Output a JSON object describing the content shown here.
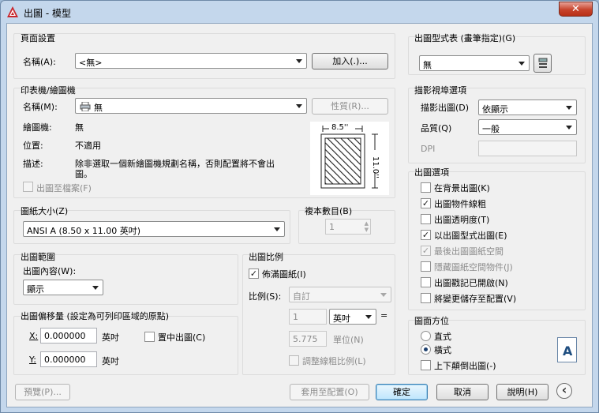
{
  "window": {
    "title": "出圖 - 模型",
    "close": "✕"
  },
  "page_setup": {
    "group": "頁面設置",
    "name_label": "名稱(A):",
    "name_value": "<無>",
    "add_button": "加入(.)..."
  },
  "printer": {
    "group": "印表機/繪圖機",
    "name_label": "名稱(M):",
    "name_value": "無",
    "properties_button": "性質(R)...",
    "plotter_label": "繪圖機:",
    "plotter_value": "無",
    "location_label": "位置:",
    "location_value": "不適用",
    "desc_label": "描述:",
    "desc_line1": "除非選取一個新繪圖機規劃名稱，否則配置將不會出",
    "desc_line2": "圖。",
    "plot_to_file": "出圖至檔案(F)",
    "paper_width": "8.5''",
    "paper_height": "11.0''"
  },
  "paper_size": {
    "group": "圖紙大小(Z)",
    "value": "ANSI A (8.50 x 11.00 英吋)"
  },
  "copies": {
    "group": "複本數目(B)",
    "value": "1"
  },
  "plot_area": {
    "group": "出圖範圍",
    "label": "出圖內容(W):",
    "value": "顯示"
  },
  "plot_offset": {
    "group": "出圖偏移量 (設定為可列印區域的原點)",
    "x_label": "X:",
    "x_value": "0.000000",
    "x_unit": "英吋",
    "y_label": "Y:",
    "y_value": "0.000000",
    "y_unit": "英吋",
    "center": "置中出圖(C)"
  },
  "plot_scale": {
    "group": "出圖比例",
    "fit": "佈滿圖紙(I)",
    "scale_label": "比例(S):",
    "scale_value": "自訂",
    "num_value": "1",
    "unit_value": "英吋",
    "equals": "=",
    "units_value": "5.775",
    "units_label": "單位(N)",
    "scale_lineweights": "調整線粗比例(L)"
  },
  "plot_style_table": {
    "group": "出圖型式表 (畫筆指定)(G)",
    "value": "無"
  },
  "shaded_viewport": {
    "group": "描影視埠選項",
    "shade_label": "描影出圖(D)",
    "shade_value": "依顯示",
    "quality_label": "品質(Q)",
    "quality_value": "一般",
    "dpi_label": "DPI"
  },
  "plot_options": {
    "group": "出圖選項",
    "items": [
      {
        "label": "在背景出圖(K)",
        "mark": ""
      },
      {
        "label": "出圖物件線粗",
        "mark": "✓"
      },
      {
        "label": "出圖透明度(T)",
        "mark": ""
      },
      {
        "label": "以出圖型式出圖(E)",
        "mark": "✓"
      },
      {
        "label": "最後出圖圖紙空間",
        "mark": "✓"
      },
      {
        "label": "隱藏圖紙空間物件(J)",
        "mark": ""
      },
      {
        "label": "出圖戳記已開啟(N)",
        "mark": ""
      },
      {
        "label": "將變更儲存至配置(V)",
        "mark": ""
      }
    ]
  },
  "orientation": {
    "group": "圖面方位",
    "portrait": "直式",
    "landscape": "橫式",
    "upside_down": "上下顛倒出圖(-)",
    "icon_letter": "A"
  },
  "footer": {
    "preview": "預覽(P)...",
    "apply": "套用至配置(O)",
    "ok": "確定",
    "cancel": "取消",
    "help": "說明(H)",
    "collapse": "‹"
  },
  "colors": {
    "accent": "#3c7fb1",
    "titlebar": "#c4d7ec",
    "close": "#c7432b"
  }
}
